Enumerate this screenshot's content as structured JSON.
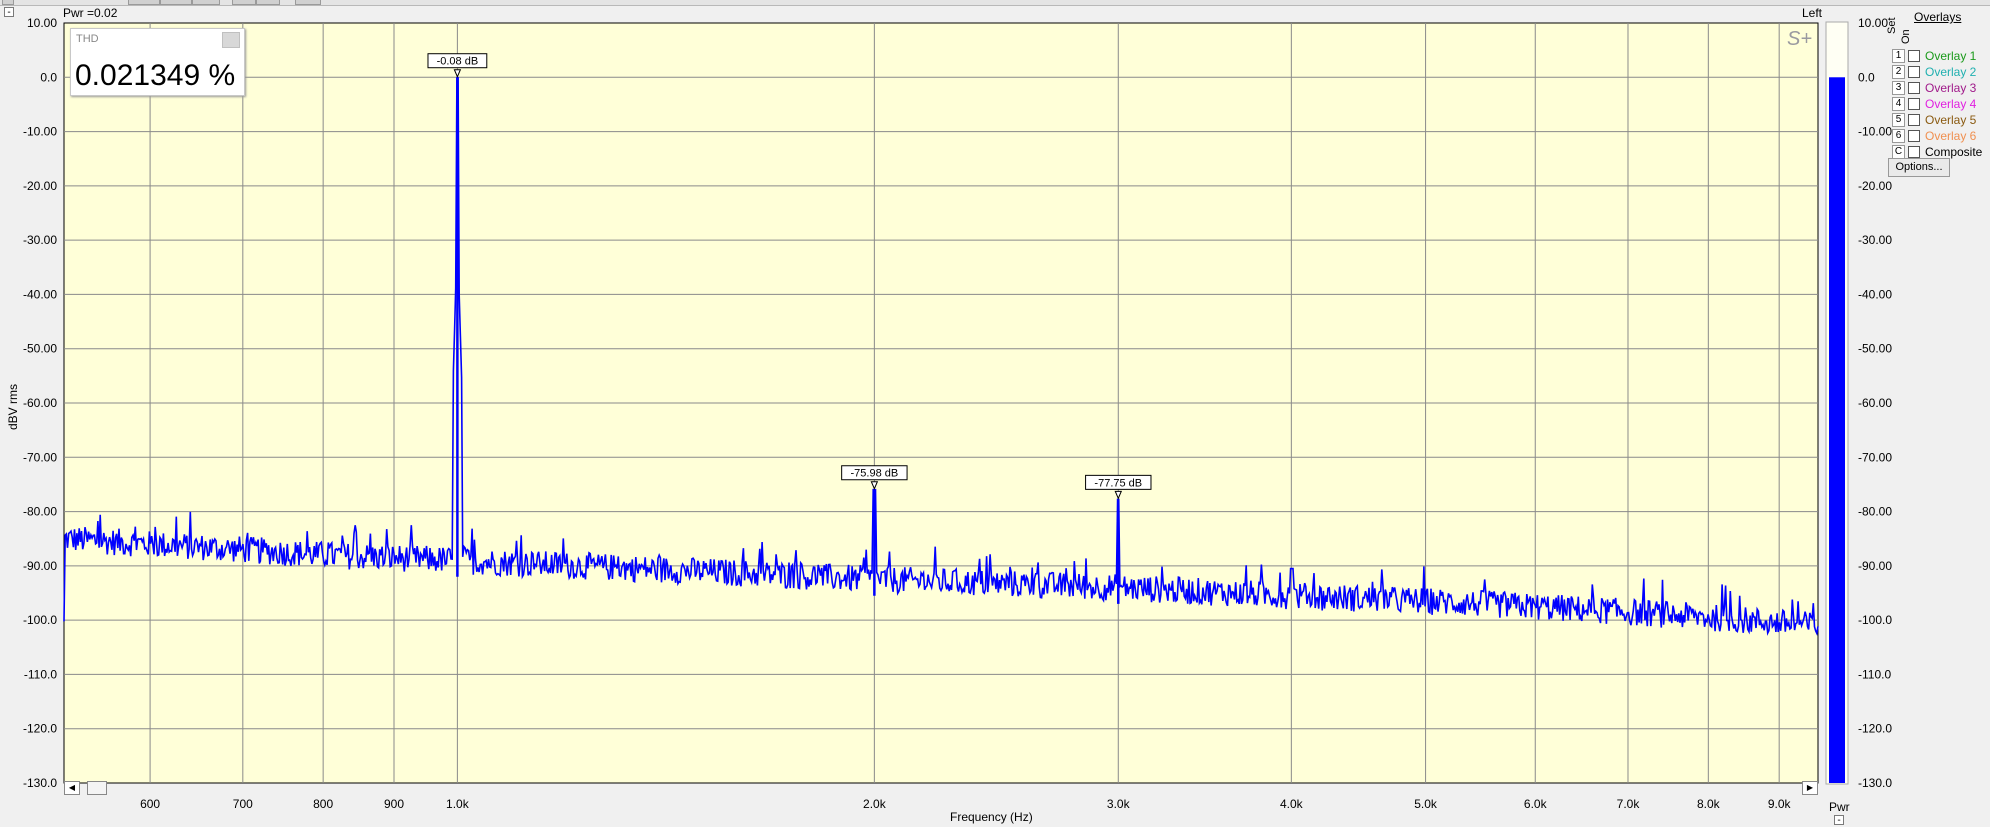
{
  "header": {
    "pwr_readout": "Pwr =0.02",
    "channel": "Left",
    "collapse_symbol": "-"
  },
  "thd_widget": {
    "label": "THD",
    "value": "0.021349 %"
  },
  "watermark": "S+",
  "overlays": {
    "title": "Overlays",
    "col_set": "Set",
    "col_on": "On",
    "rows": [
      {
        "num": "1",
        "name": "Overlay 1",
        "color": "#1a9a1a"
      },
      {
        "num": "2",
        "name": "Overlay 2",
        "color": "#20b0b0"
      },
      {
        "num": "3",
        "name": "Overlay 3",
        "color": "#a01a8a"
      },
      {
        "num": "4",
        "name": "Overlay 4",
        "color": "#e020e0"
      },
      {
        "num": "5",
        "name": "Overlay 5",
        "color": "#8a5a10"
      },
      {
        "num": "6",
        "name": "Overlay 6",
        "color": "#f09050"
      },
      {
        "num": "C",
        "name": "Composite",
        "color": "#000000"
      }
    ],
    "options_label": "Options..."
  },
  "level_meter": {
    "label": "Pwr",
    "value_dB": 0.0,
    "ticks": [
      "10.00",
      "0.0",
      "-10.00",
      "-20.00",
      "-30.00",
      "-40.00",
      "-50.00",
      "-60.00",
      "-70.00",
      "-80.00",
      "-90.00",
      "-100.0",
      "-110.0",
      "-120.0",
      "-130.0"
    ],
    "color": "#0000ff"
  },
  "chart_data": {
    "type": "line",
    "xlabel": "Frequency (Hz)",
    "ylabel": "dBV rms",
    "xscale": "log",
    "xlim": [
      520,
      9600
    ],
    "ylim": [
      -130,
      10
    ],
    "background": "#ffffd8",
    "grid": true,
    "series_color": "#0000ff",
    "y_ticks": [
      "10.00",
      "0.0",
      "-10.00",
      "-20.00",
      "-30.00",
      "-40.00",
      "-50.00",
      "-60.00",
      "-70.00",
      "-80.00",
      "-90.00",
      "-100.0",
      "-110.0",
      "-120.0",
      "-130.0"
    ],
    "x_ticks": [
      {
        "v": 600,
        "label": "600"
      },
      {
        "v": 700,
        "label": "700"
      },
      {
        "v": 800,
        "label": "800"
      },
      {
        "v": 900,
        "label": "900"
      },
      {
        "v": 1000,
        "label": "1.0k"
      },
      {
        "v": 2000,
        "label": "2.0k"
      },
      {
        "v": 3000,
        "label": "3.0k"
      },
      {
        "v": 4000,
        "label": "4.0k"
      },
      {
        "v": 5000,
        "label": "5.0k"
      },
      {
        "v": 6000,
        "label": "6.0k"
      },
      {
        "v": 7000,
        "label": "7.0k"
      },
      {
        "v": 8000,
        "label": "8.0k"
      },
      {
        "v": 9000,
        "label": "9.0k"
      }
    ],
    "noise_floor": [
      {
        "f": 520,
        "db": -85
      },
      {
        "f": 600,
        "db": -86
      },
      {
        "f": 700,
        "db": -87
      },
      {
        "f": 800,
        "db": -88
      },
      {
        "f": 900,
        "db": -88.5
      },
      {
        "f": 1000,
        "db": -89
      },
      {
        "f": 1500,
        "db": -91
      },
      {
        "f": 2000,
        "db": -92.5
      },
      {
        "f": 3000,
        "db": -94
      },
      {
        "f": 4000,
        "db": -95.5
      },
      {
        "f": 5000,
        "db": -96.5
      },
      {
        "f": 6000,
        "db": -97.5
      },
      {
        "f": 7000,
        "db": -98.5
      },
      {
        "f": 8000,
        "db": -99.5
      },
      {
        "f": 9000,
        "db": -100.5
      },
      {
        "f": 9600,
        "db": -101
      }
    ],
    "peaks": [
      {
        "f": 1000,
        "db": -0.08,
        "label": "-0.08 dB"
      },
      {
        "f": 2000,
        "db": -75.98,
        "label": "-75.98 dB"
      },
      {
        "f": 3000,
        "db": -77.75,
        "label": "-77.75 dB"
      }
    ],
    "spurs": [
      {
        "f": 4000,
        "db": -90.5
      },
      {
        "f": 1000,
        "db": -69,
        "note_skirt": true
      }
    ]
  }
}
